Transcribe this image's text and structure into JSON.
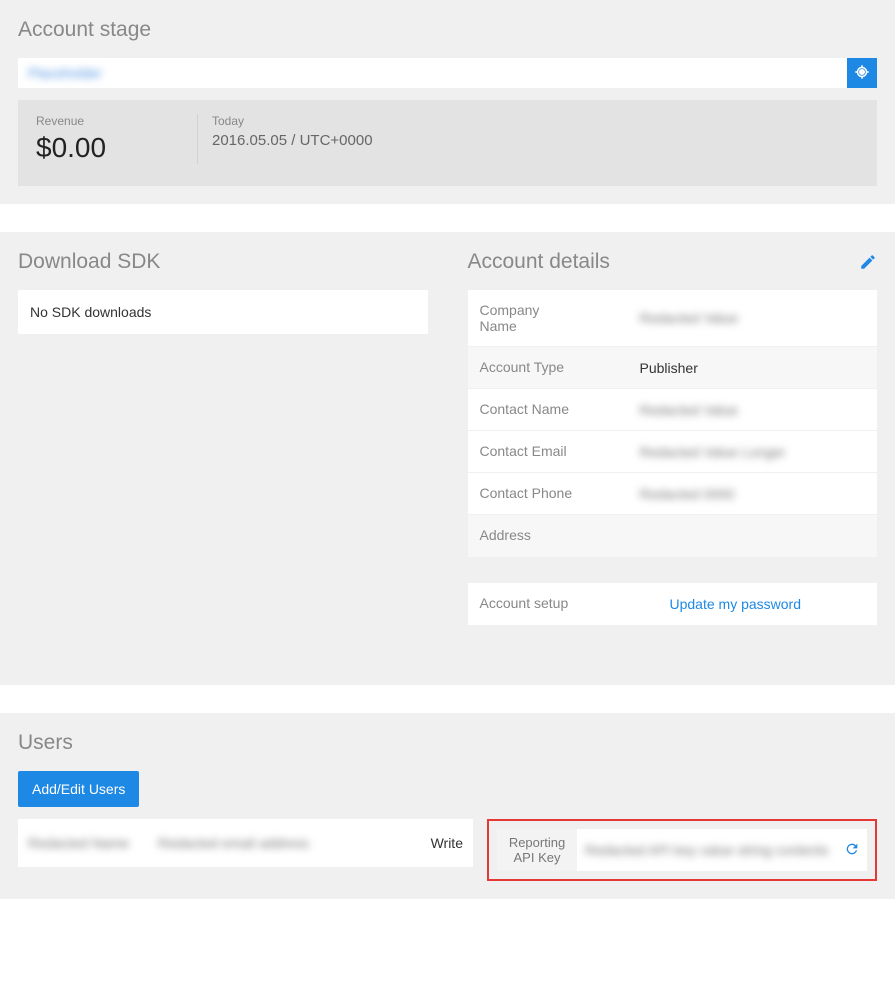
{
  "account_stage": {
    "title": "Account stage",
    "search_value": "Placeholder",
    "revenue_label": "Revenue",
    "revenue_value": "$0.00",
    "today_label": "Today",
    "today_value": "2016.05.05 / UTC+0000"
  },
  "download_sdk": {
    "title": "Download SDK",
    "empty_text": "No SDK downloads"
  },
  "account_details": {
    "title": "Account details",
    "rows": {
      "company_name_label": "Company\nName",
      "company_name_value": "Redacted Value",
      "account_type_label": "Account Type",
      "account_type_value": "Publisher",
      "contact_name_label": "Contact Name",
      "contact_name_value": "Redacted Value",
      "contact_email_label": "Contact Email",
      "contact_email_value": "Redacted Value Longer",
      "contact_phone_label": "Contact Phone",
      "contact_phone_value": "Redacted 0000",
      "address_label": "Address",
      "account_setup_label": "Account setup",
      "account_setup_link": "Update my password"
    }
  },
  "users": {
    "title": "Users",
    "add_edit_button": "Add/Edit Users",
    "row": {
      "name": "Redacted Name",
      "email": "Redacted email address",
      "permission": "Write"
    },
    "api_key_label": "Reporting API Key",
    "api_key_value": "Redacted API key value string contents"
  }
}
